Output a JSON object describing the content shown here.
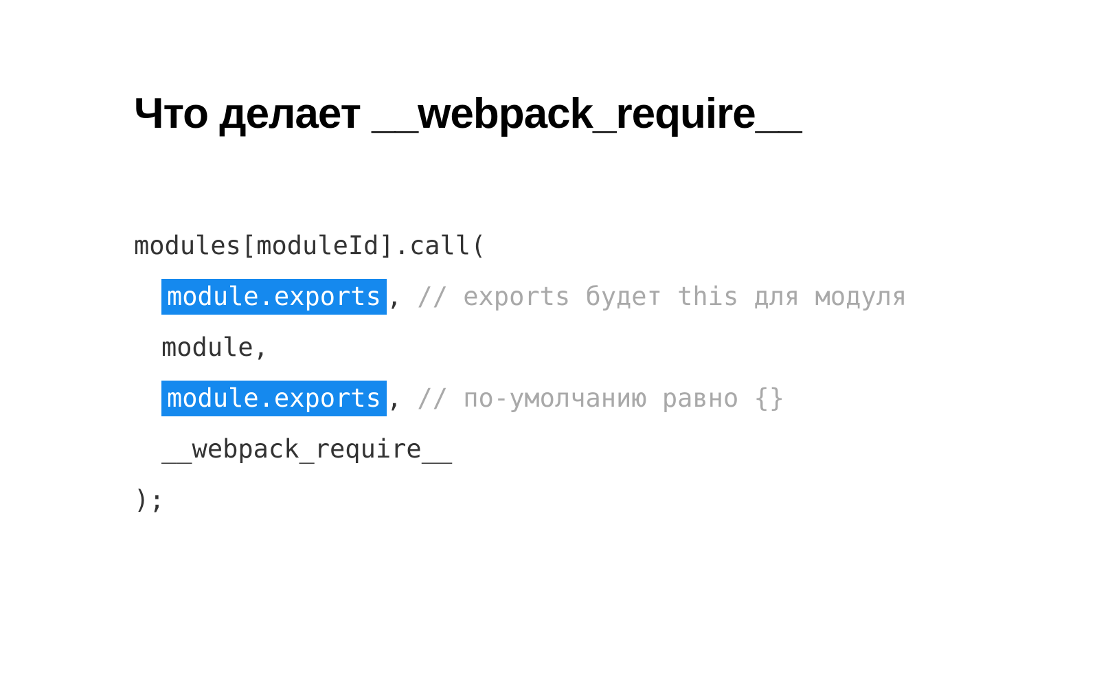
{
  "title": "Что делает __webpack_require__",
  "code": {
    "line1": "modules[moduleId].call(",
    "line2_highlight": "module.exports",
    "line2_after": ",",
    "line2_comment": " // exports будет this для модуля",
    "line3": "module,",
    "line4_highlight": "module.exports",
    "line4_after": ",",
    "line4_comment": " // по-умолчанию равно {}",
    "line5": "__webpack_require__",
    "line6": ");"
  }
}
